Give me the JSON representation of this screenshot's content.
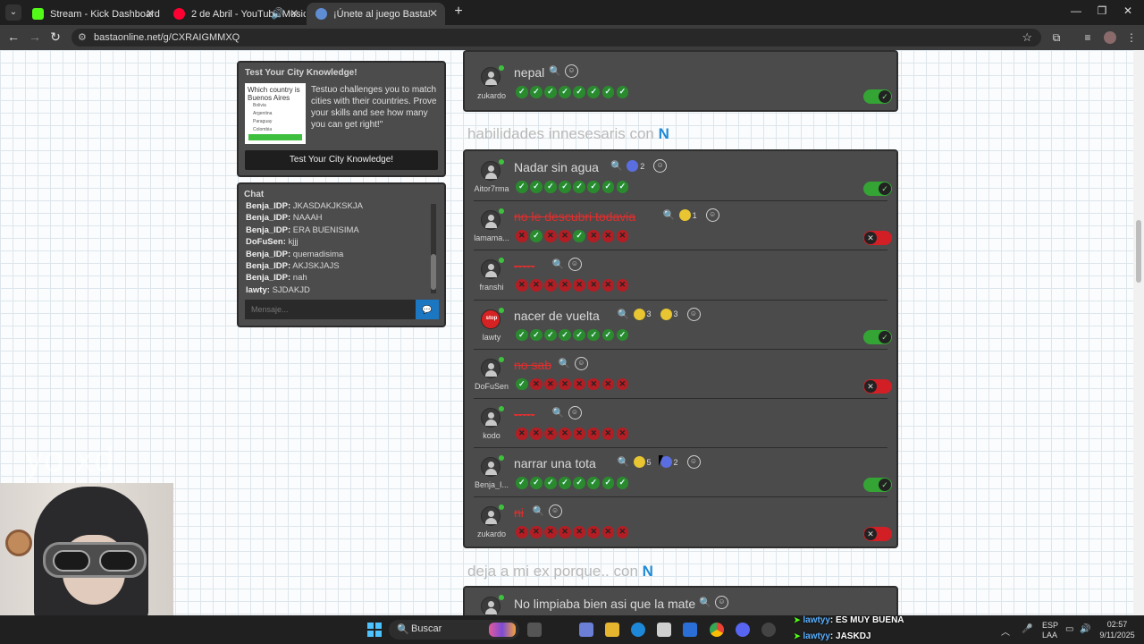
{
  "browser": {
    "tabs": [
      {
        "title": "Stream - Kick Dashboard",
        "color": "#53fc18"
      },
      {
        "title": "2 de Abril - YouTube Music",
        "color": "#ff0033"
      },
      {
        "title": "¡Únete al juego Basta!",
        "color": "#5f8dd3"
      }
    ],
    "url": "bastaonline.net/g/CXRAIGMMXQ"
  },
  "ad": {
    "title": "Test Your City Knowledge!",
    "thumb_question": "Which country is Buenos Aires",
    "thumb_options": [
      "Bolivia",
      "Argentina",
      "Paraguay",
      "Colombia"
    ],
    "description": "Testuo challenges you to match cities with their countries. Prove your skills and see how many you can get right!\"",
    "button": "Test Your City Knowledge!"
  },
  "chat": {
    "title": "Chat",
    "messages": [
      {
        "user": "Benja_IDP:",
        "text": "JKASDAKJKSKJA"
      },
      {
        "user": "Benja_IDP:",
        "text": "NAAAH"
      },
      {
        "user": "Benja_IDP:",
        "text": "ERA BUENISIMA"
      },
      {
        "user": "DoFuSen:",
        "text": "kjjj"
      },
      {
        "user": "Benja_IDP:",
        "text": "quemadisima"
      },
      {
        "user": "Benja_IDP:",
        "text": "AKJSKJAJS"
      },
      {
        "user": "Benja_IDP:",
        "text": "nah"
      },
      {
        "user": "lawty:",
        "text": "SJDAKJD"
      }
    ],
    "placeholder": "Mensaje..."
  },
  "prev_row": {
    "user": "zukardo",
    "answer": "nepal",
    "votes": [
      "ok",
      "ok",
      "ok",
      "ok",
      "ok",
      "ok",
      "ok",
      "ok"
    ],
    "valid": true
  },
  "categories": [
    {
      "title": "habilidades innesesaris con",
      "letter": "N",
      "rows": [
        {
          "user": "Aitor7rma",
          "answer": "Nadar sin agua",
          "valid": true,
          "avatar": "default",
          "badges": [
            {
              "type": "like",
              "count": "2"
            }
          ],
          "votes": [
            "ok",
            "ok",
            "ok",
            "ok",
            "ok",
            "ok",
            "ok",
            "ok"
          ]
        },
        {
          "user": "lamama...",
          "answer": "no le descubri todavia",
          "valid": false,
          "avatar": "default",
          "badges": [
            {
              "type": "coin",
              "count": "1"
            }
          ],
          "votes": [
            "no",
            "ok",
            "no",
            "no",
            "ok",
            "no",
            "no",
            "no"
          ]
        },
        {
          "user": "franshi",
          "answer": "-----",
          "valid": null,
          "avatar": "default",
          "badges": [],
          "votes": [
            "no",
            "no",
            "no",
            "no",
            "no",
            "no",
            "no",
            "no"
          ]
        },
        {
          "user": "lawty",
          "answer": "nacer de vuelta",
          "valid": true,
          "avatar": "stop",
          "badges": [
            {
              "type": "coin",
              "count": "3"
            },
            {
              "type": "coin",
              "count": "3"
            }
          ],
          "votes": [
            "ok",
            "ok",
            "ok",
            "ok",
            "ok",
            "ok",
            "ok",
            "ok"
          ]
        },
        {
          "user": "DoFuSen",
          "answer": "no sab",
          "valid": false,
          "avatar": "default",
          "badges": [],
          "votes": [
            "ok",
            "no",
            "no",
            "no",
            "no",
            "no",
            "no",
            "no"
          ]
        },
        {
          "user": "kodo",
          "answer": "-----",
          "valid": null,
          "avatar": "default",
          "badges": [],
          "votes": [
            "no",
            "no",
            "no",
            "no",
            "no",
            "no",
            "no",
            "no"
          ]
        },
        {
          "user": "Benja_I...",
          "answer": "narrar una tota",
          "valid": true,
          "avatar": "default",
          "badges": [
            {
              "type": "coin",
              "count": "5"
            },
            {
              "type": "like",
              "count": "2"
            }
          ],
          "votes": [
            "ok",
            "ok",
            "ok",
            "ok",
            "ok",
            "ok",
            "ok",
            "ok"
          ]
        },
        {
          "user": "zukardo",
          "answer": "ni",
          "valid": false,
          "avatar": "default",
          "badges": [],
          "votes": [
            "no",
            "no",
            "no",
            "no",
            "no",
            "no",
            "no",
            "no"
          ]
        }
      ]
    },
    {
      "title": "deja a mi ex porque.. con",
      "letter": "N",
      "rows": [
        {
          "user": "",
          "answer": "No limpiaba bien asi que la mate",
          "valid": null,
          "avatar": "default",
          "badges": [],
          "votes": []
        }
      ]
    }
  ],
  "stop_label": "stop",
  "webcam_watermark": "yo xd",
  "taskbar": {
    "search_placeholder": "Buscar",
    "lang": "ESP",
    "lang2": "LAA",
    "time": "02:57",
    "date": "9/11/2025"
  },
  "overlay_chat": [
    {
      "user": "lawtyy",
      "text": ": ES MUY BUENA"
    },
    {
      "user": "lawtyy",
      "text": ": JASKDJ"
    }
  ]
}
